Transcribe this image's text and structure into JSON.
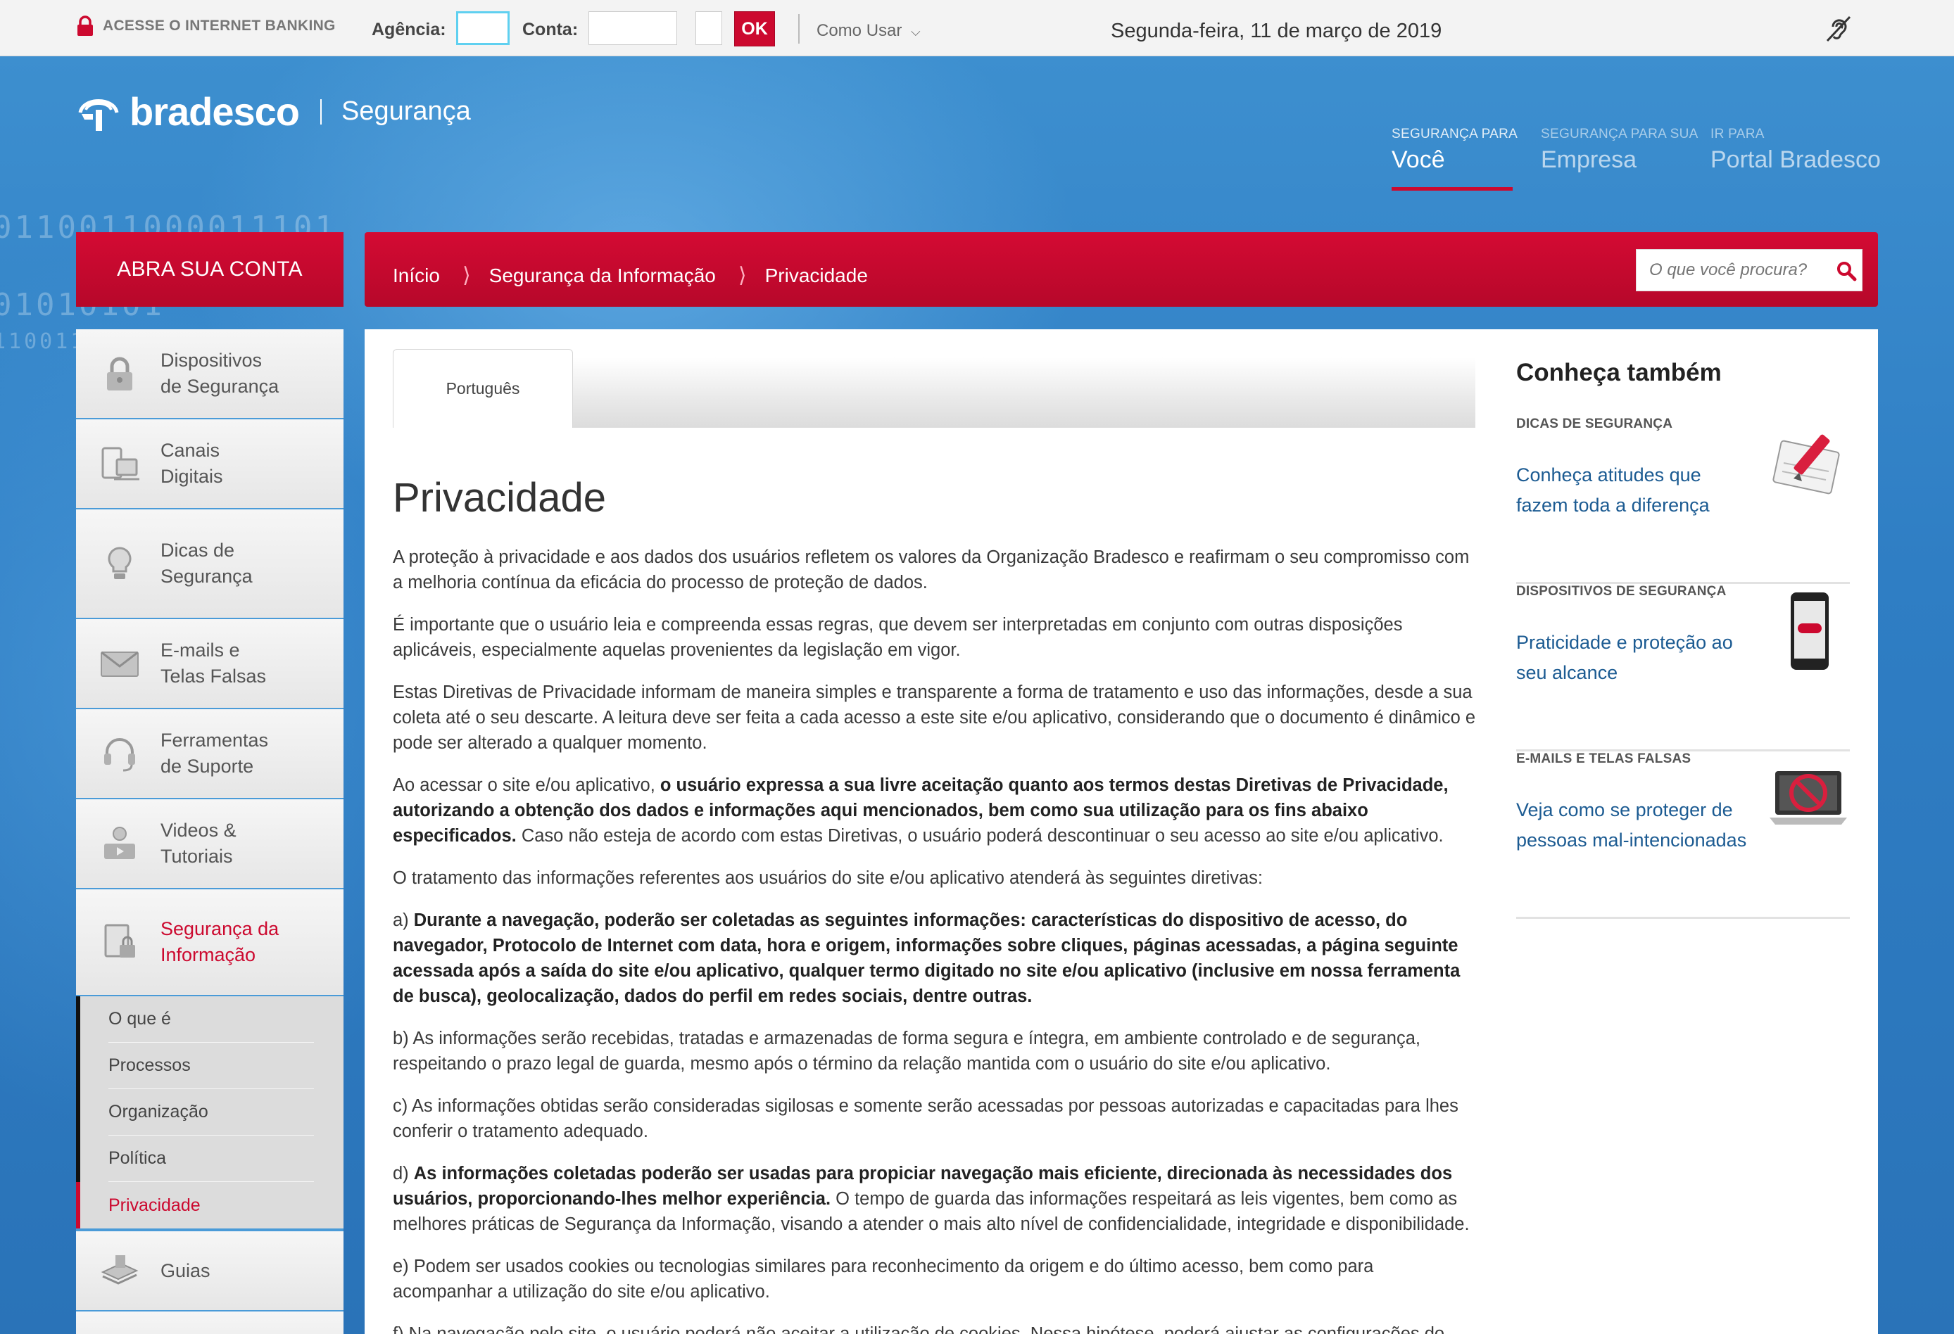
{
  "topbar": {
    "internet_banking": "ACESSE O INTERNET BANKING",
    "agencia_label": "Agência:",
    "agencia_value": "",
    "conta_label": "Conta:",
    "conta_value": "",
    "digito_value": "",
    "ok_label": "OK",
    "como_usar": "Como Usar",
    "date": "Segunda-feira, 11 de março de 2019",
    "hearing_icon": "hearing-accessibility-icon"
  },
  "header": {
    "brand": "bradesco",
    "section": "Segurança",
    "nav": [
      {
        "small": "SEGURANÇA PARA",
        "big": "Você"
      },
      {
        "small": "SEGURANÇA PARA SUA",
        "big": "Empresa"
      },
      {
        "small": "IR PARA",
        "big": "Portal Bradesco"
      }
    ]
  },
  "abra_conta": "ABRA SUA CONTA",
  "breadcrumb": [
    "Início",
    "Segurança da Informação",
    "Privacidade"
  ],
  "search": {
    "placeholder": "O que você procura?"
  },
  "sidebar": {
    "items": [
      {
        "label": "Dispositivos\nde Segurança",
        "icon": "lock-icon"
      },
      {
        "label": "Canais\nDigitais",
        "icon": "devices-icon"
      },
      {
        "label": "Dicas de\nSegurança",
        "icon": "lightbulb-icon"
      },
      {
        "label": "E-mails e\nTelas Falsas",
        "icon": "envelope-icon"
      },
      {
        "label": "Ferramentas\nde Suporte",
        "icon": "headset-icon"
      },
      {
        "label": "Videos &\nTutoriais",
        "icon": "video-tutorial-icon"
      },
      {
        "label": "Segurança da\nInformação",
        "icon": "secure-document-icon"
      },
      {
        "label": "Guias",
        "icon": "guide-book-icon"
      }
    ],
    "subitems": [
      "O que é",
      "Processos",
      "Organização",
      "Política",
      "Privacidade"
    ]
  },
  "content": {
    "tab": "Português",
    "title": "Privacidade",
    "p1": "A proteção à privacidade e aos dados dos usuários refletem os valores da Organização Bradesco e reafirmam o seu compromisso com a melhoria contínua da eficácia do processo de proteção de dados.",
    "p2": "É importante que o usuário leia e compreenda essas regras, que devem ser interpretadas em conjunto com outras disposições aplicáveis, especialmente aquelas provenientes da legislação em vigor.",
    "p3": "Estas Diretivas de Privacidade informam de maneira simples e transparente a forma de tratamento e uso das informações, desde a sua coleta até o seu descarte. A leitura deve ser feita a cada acesso a este site e/ou aplicativo, considerando que o documento é dinâmico e pode ser alterado a qualquer momento.",
    "p4_a": "Ao acessar o site e/ou aplicativo, ",
    "p4_b": "o usuário expressa a sua livre aceitação quanto aos termos destas Diretivas de Privacidade, autorizando a obtenção dos dados e informações aqui mencionados, bem como sua utilização para os fins abaixo especificados.",
    "p4_c": " Caso não esteja de acordo com estas Diretivas, o usuário poderá descontinuar o seu acesso ao site e/ou aplicativo.",
    "p5": "O tratamento das informações referentes aos usuários do site e/ou aplicativo atenderá às seguintes diretivas:",
    "pa_a": "a) ",
    "pa_b": "Durante a navegação, poderão ser coletadas as seguintes informações: características do dispositivo de acesso, do navegador, Protocolo de Internet com data, hora e origem, informações sobre cliques, páginas acessadas, a página seguinte acessada após a saída do site e/ou aplicativo, qualquer termo digitado no site e/ou aplicativo (inclusive em nossa ferramenta de busca), geolocalização, dados do perfil em redes sociais, dentre outras.",
    "pb": "b) As informações serão recebidas, tratadas e armazenadas de forma segura e íntegra, em ambiente controlado e de segurança, respeitando o prazo legal de guarda, mesmo após o término da relação mantida com o usuário do site e/ou aplicativo.",
    "pc": "c) As informações obtidas serão consideradas sigilosas e somente serão acessadas por pessoas autorizadas e capacitadas para lhes conferir o tratamento adequado.",
    "pd_a": "d) ",
    "pd_b": "As informações coletadas poderão ser usadas para propiciar navegação mais eficiente, direcionada às necessidades dos usuários, proporcionando-lhes melhor experiência.",
    "pd_c": " O tempo de guarda das informações respeitará as leis vigentes, bem como as melhores práticas de Segurança da Informação, visando a atender o mais alto nível de confidencialidade, integridade e disponibilidade.",
    "pe": "e) Podem ser usados cookies ou tecnologias similares para reconhecimento da origem e do último acesso, bem como para acompanhar a utilização do site e/ou aplicativo.",
    "pf": "f) Na navegação pelo site, o usuário poderá não aceitar a utilização de cookies. Nessa hipótese, poderá ajustar as configurações do"
  },
  "right_col": {
    "title": "Conheça também",
    "cards": [
      {
        "kicker": "DICAS DE SEGURANÇA",
        "link": "Conheça atitudes que fazem toda a diferença",
        "icon": "notepad-pencil-icon"
      },
      {
        "kicker": "DISPOSITIVOS DE SEGURANÇA",
        "link": "Praticidade e proteção ao seu alcance",
        "icon": "smartphone-icon"
      },
      {
        "kicker": "E-MAILS E TELAS FALSAS",
        "link": "Veja como se proteger de pessoas mal-intencionadas",
        "icon": "no-malware-laptop-icon"
      }
    ]
  },
  "colors": {
    "brand_red": "#cc092f",
    "link_blue": "#1c5b92",
    "bg_blue": "#2f78b8"
  }
}
